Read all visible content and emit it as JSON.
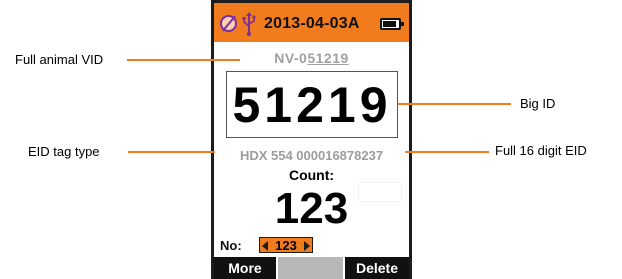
{
  "status_bar": {
    "date": "2013-04-03A",
    "battery_level": 0.85,
    "icons": [
      "sync-off-icon",
      "usb-icon",
      "battery-icon"
    ]
  },
  "screen": {
    "vid_prefix": "NV-0",
    "vid_underlined": "51219",
    "big_id": "51219",
    "eid": "HDX 554 000016878237",
    "count_label": "Count:",
    "count_value": "123",
    "no_label": "No:",
    "no_value": "123"
  },
  "softkeys": {
    "left": "More",
    "middle": "",
    "right": "Delete"
  },
  "callouts": {
    "full_vid": "Full animal VID",
    "big_id": "Big ID",
    "tag_type": "EID tag type",
    "full_eid": "Full 16 digit EID"
  },
  "colors": {
    "accent": "#f07c1d",
    "softkey": "#111111",
    "muted_text": "#a0a0a0"
  }
}
